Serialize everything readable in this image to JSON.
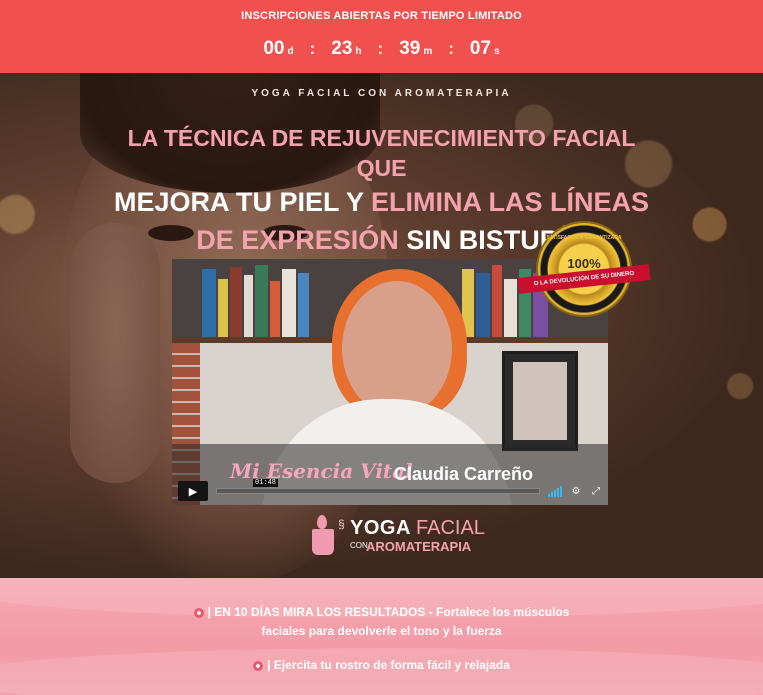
{
  "topbar": {
    "promo": "INSCRIPCIONES ABIERTAS POR TIEMPO LIMITADO",
    "countdown": {
      "days": "00",
      "days_unit": "d",
      "hours": "23",
      "hours_unit": "h",
      "minutes": "39",
      "minutes_unit": "m",
      "seconds": "07",
      "seconds_unit": "s",
      "separator": ":"
    }
  },
  "hero": {
    "subtitle": "YOGA FACIAL CON AROMATERAPIA",
    "headline": {
      "line1": "LA TÉCNICA DE REJUVENECIMIENTO FACIAL QUE",
      "line2_white": "MEJORA TU PIEL Y ",
      "line2_pink": "ELIMINA LAS LÍNEAS",
      "line3_pink": "DE EXPRESIÓN ",
      "line3_white": "SIN BISTURÍ"
    }
  },
  "seal": {
    "top_text": "SATISFACCIÓN GARANTIZADA",
    "percent": "100%",
    "ribbon": "O LA DEVOLUCIÓN DE SU DINERO"
  },
  "video": {
    "brand_left": "Mi Esencia Vital",
    "presenter": "Claudia Carreño",
    "time": "01:48",
    "progress": 0
  },
  "logo": {
    "yoga": "YOGA",
    "facial": "FACIAL",
    "con": "CON",
    "aroma": "AROMATERAPIA"
  },
  "benefits": [
    {
      "text_line1": "| EN 10 DÍAS MIRA LOS RESULTADOS - Fortalece los músculos",
      "text_line2": "faciales para devolverle el tono y la fuerza"
    },
    {
      "text_line1": "| Ejercita tu rostro de forma fácil y relajada"
    }
  ],
  "colors": {
    "topbar": "#f0504e",
    "pink_accent": "#f4a3ad",
    "bottom_bg": "#f39ba6"
  },
  "icons": [
    "play-icon",
    "volume-icon",
    "settings-gear-icon",
    "fullscreen-icon",
    "flower-icon",
    "candle-icon"
  ]
}
